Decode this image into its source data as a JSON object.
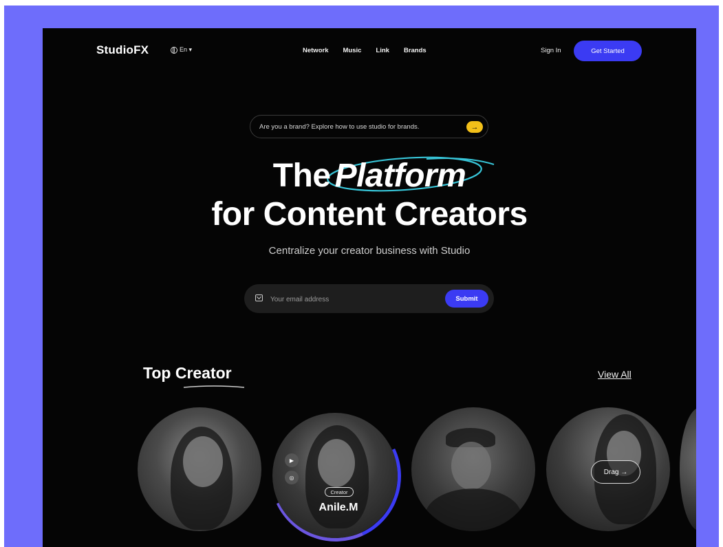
{
  "nav": {
    "brand": "StudioFX",
    "language": "En ▾",
    "links": [
      "Network",
      "Music",
      "Link",
      "Brands"
    ],
    "sign_in": "Sign In",
    "get_started": "Get Started"
  },
  "hero": {
    "announcement": "Are you a brand? Explore how to use studio for brands.",
    "announcement_icon": "arrow-right-icon",
    "headline_line1_prefix": "The",
    "headline_highlight": "Platform",
    "headline_line2": "for Content Creators",
    "subheadline": "Centralize your creator business with Studio",
    "email_placeholder": "Your email address",
    "submit": "Submit"
  },
  "top_creator": {
    "title": "Top Creator",
    "view_all": "View All",
    "featured": {
      "tag": "Creator",
      "name": "Anile.M",
      "socials": [
        "youtube-icon",
        "instagram-icon"
      ]
    },
    "drag_label": "Drag →"
  },
  "colors": {
    "frame": "#6e6dfb",
    "background": "#050505",
    "accent": "#3b3bf3",
    "highlight_ring": "#38c6d9",
    "pill_button": "#f3c019"
  }
}
